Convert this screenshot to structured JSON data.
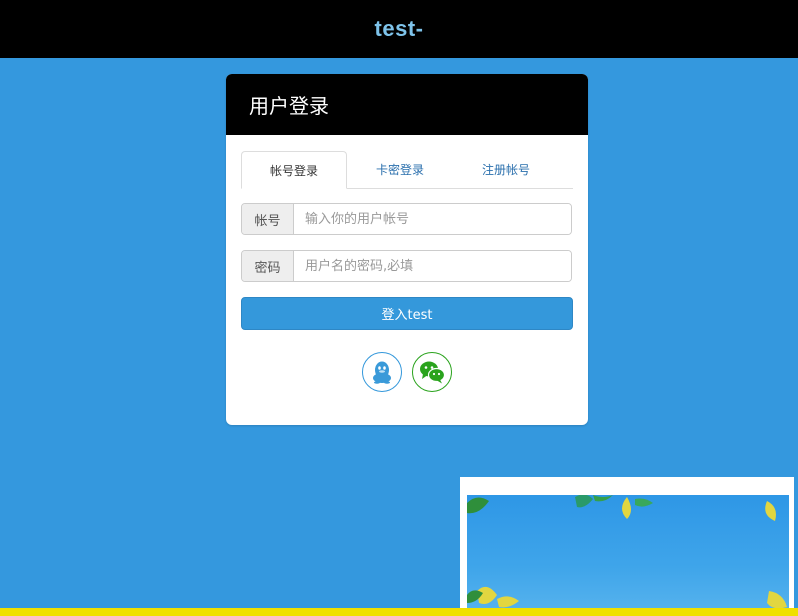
{
  "header": {
    "site_title": "test-"
  },
  "panel": {
    "title": "用户登录"
  },
  "tabs": [
    {
      "label": "帐号登录",
      "active": true
    },
    {
      "label": "卡密登录",
      "active": false
    },
    {
      "label": "注册帐号",
      "active": false
    }
  ],
  "form": {
    "account": {
      "label": "帐号",
      "placeholder": "输入你的用户帐号",
      "value": ""
    },
    "password": {
      "label": "密码",
      "placeholder": "用户名的密码,必填",
      "value": ""
    },
    "submit_label": "登入test"
  },
  "social_login": [
    {
      "icon": "qq-penguin-icon",
      "color": "#3498db"
    },
    {
      "icon": "wechat-icon",
      "color": "#2aa31d"
    }
  ],
  "colors": {
    "page_bg": "#3498de",
    "header_bg": "#000000",
    "title_accent": "#7ec3ea",
    "primary": "#3498db",
    "bottom_bar": "#f0e000"
  }
}
